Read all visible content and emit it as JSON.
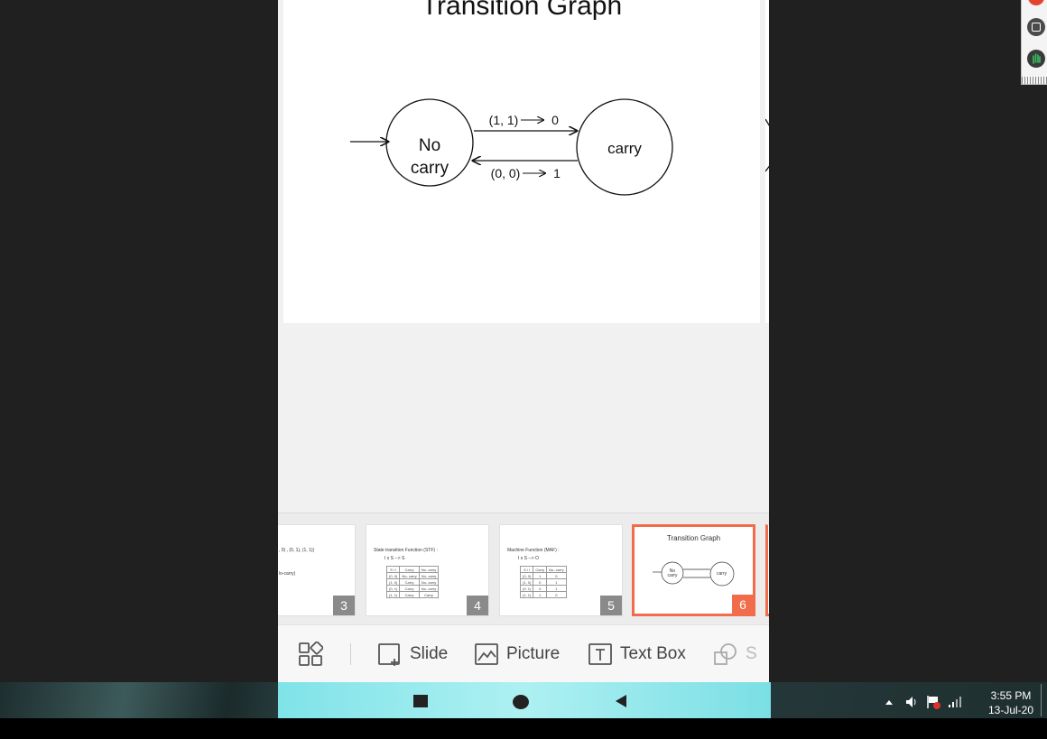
{
  "slide": {
    "title": "Transition Graph",
    "graph": {
      "state_left_line1": "No",
      "state_left_line2": "carry",
      "state_right": "carry",
      "edge_top": "(1, 1)",
      "edge_top_out": "0",
      "edge_bottom": "(0, 0)",
      "edge_bottom_out": "1"
    }
  },
  "thumbnails": [
    {
      "number": "3",
      "text_line1": ", 0) , (0, 1), (1, 1))",
      "text_line2": "lo-carry)"
    },
    {
      "number": "4",
      "heading": "State transition Function (STF) :",
      "sub": "I x S --> S",
      "table_header": [
        "S / I",
        "Carry",
        "No- carry"
      ],
      "table_rows": [
        [
          "(0, 0)",
          "No- carry",
          "No- carry"
        ],
        [
          "(1, 0)",
          "Carry",
          "No- carry"
        ],
        [
          "(0, 1)",
          "Carry",
          "No- carry"
        ],
        [
          "(1, 1)",
          "Carry",
          "Carry"
        ]
      ]
    },
    {
      "number": "5",
      "heading": "Machine Function (MAF) :",
      "sub": "I x S --> O",
      "table_header": [
        "S / I",
        "Carry",
        "No- carry"
      ],
      "table_rows": [
        [
          "(0, 0)",
          "1",
          "0"
        ],
        [
          "(1, 0)",
          "0",
          "1"
        ],
        [
          "(0, 1)",
          "0",
          "1"
        ],
        [
          "(1, 1)",
          "1",
          "0"
        ]
      ]
    },
    {
      "number": "6",
      "title": "Transition Graph",
      "state_left": "No carry",
      "state_right": "carry",
      "selected": true
    }
  ],
  "toolbar": {
    "slide_label": "Slide",
    "picture_label": "Picture",
    "textbox_label": "Text Box",
    "shape_label": "S"
  },
  "tray": {
    "time": "3:55 PM",
    "date": "13-Jul-20"
  },
  "colors": {
    "accent": "#f06c4a",
    "phone_nav": "#8fe6ea",
    "background": "#202020"
  }
}
